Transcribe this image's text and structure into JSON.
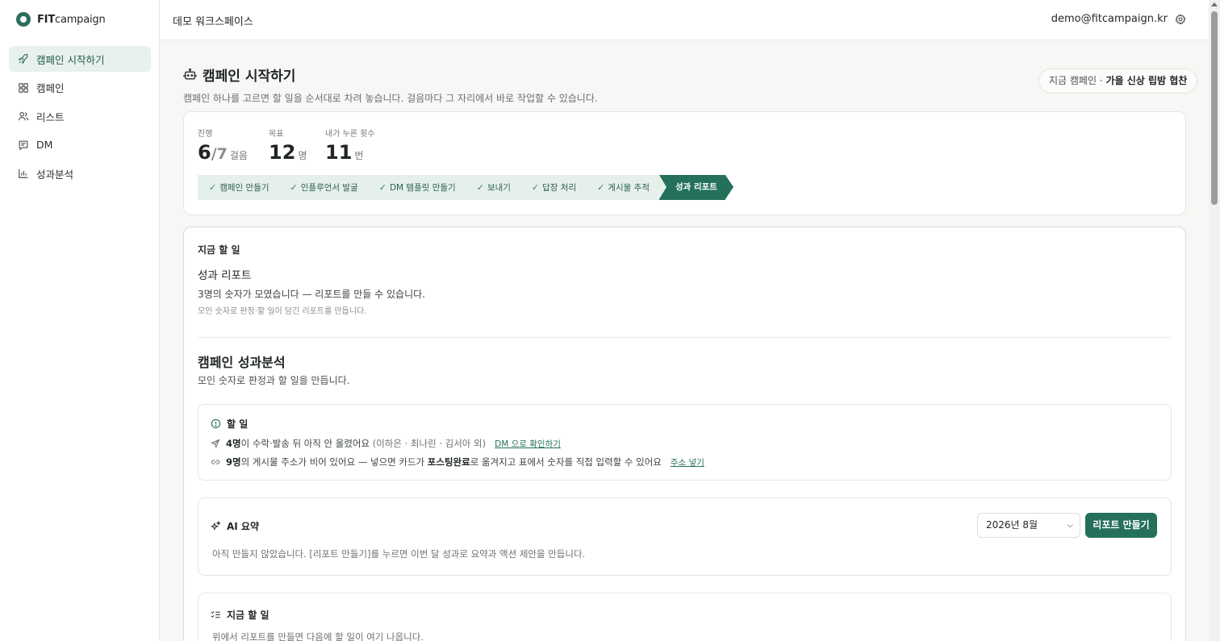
{
  "brand": {
    "name_bold": "FIT",
    "name_rest": "campaign"
  },
  "sidebar": {
    "items": [
      {
        "label": "캠페인 시작하기",
        "icon": "rocket-icon",
        "active": true
      },
      {
        "label": "캠페인",
        "icon": "grid-icon"
      },
      {
        "label": "리스트",
        "icon": "users-icon"
      },
      {
        "label": "DM",
        "icon": "message-icon"
      },
      {
        "label": "성과분석",
        "icon": "bar-chart-icon"
      }
    ]
  },
  "topbar": {
    "workspace": "데모 워크스페이스",
    "email": "demo@fitcampaign.kr",
    "settings_icon": "gear-icon"
  },
  "page": {
    "title": "캠페인 시작하기",
    "title_icon": "robot-icon",
    "subtitle": "캠페인 하나를 고르면 할 일을 순서대로 차려 놓습니다. 걸음마다 그 자리에서 바로 작업할 수 있습니다.",
    "current_label": "지금 캠페인 · ",
    "current_name": "가을 신상 립밤 협찬"
  },
  "progress": {
    "progress_label": "진행",
    "progress_value": "6",
    "progress_total": "/7",
    "progress_unit": "걸음",
    "goal_label": "목표",
    "goal_value": "12",
    "goal_unit": "명",
    "clicks_label": "내가 누른 횟수",
    "clicks_value": "11",
    "clicks_unit": "번",
    "steps": [
      {
        "label": "캠페인 만들기",
        "done": true
      },
      {
        "label": "인플루언서 발굴",
        "done": true
      },
      {
        "label": "DM 템플릿 만들기",
        "done": true
      },
      {
        "label": "보내기",
        "done": true
      },
      {
        "label": "답장 처리",
        "done": true
      },
      {
        "label": "게시물 추적",
        "done": true
      },
      {
        "label": "성과 리포트",
        "done": false,
        "current": true
      }
    ],
    "check_glyph": "✓"
  },
  "now": {
    "label": "지금 할 일",
    "title": "성과 리포트",
    "desc": "3명의 숫자가 모였습니다 — 리포트를 만들 수 있습니다.",
    "note": "모인 숫자로 판정·할 일이 담긴 리포트를 만듭니다."
  },
  "analysis": {
    "title": "캠페인 성과분석",
    "subtitle": "모인 숫자로 판정과 할 일을 만듭니다.",
    "todo": {
      "title": "할 일",
      "icon": "alert-circle-icon",
      "row1": {
        "icon": "send-icon",
        "count": "4명",
        "text": "이 수락·발송 뒤 아직 안 올렸어요",
        "names": "(이하은 · 최나린 · 김서아 외)",
        "link": "DM 으로 확인하기"
      },
      "row2": {
        "icon": "link-icon",
        "count": "9명",
        "text_a": "의 게시물 주소가 비어 있어요 — 넣으면 카드가 ",
        "bold": "포스팅완료",
        "text_b": "로 옮겨지고 표에서 숫자를 직접 입력할 수 있어요",
        "link": "주소 넣기"
      }
    },
    "ai": {
      "title": "AI 요약",
      "icon": "sparkles-icon",
      "month": "2026년 8월",
      "button": "리포트 만들기",
      "desc": "아직 만들지 않았습니다. [리포트 만들기]를 누르면 이번 달 성과로 요약과 액션 제안을 만듭니다."
    },
    "next": {
      "title": "지금 할 일",
      "icon": "list-check-icon",
      "desc": "위에서 리포트를 만들면 다음에 할 일이 여기 나옵니다."
    }
  },
  "colors": {
    "accent": "#24705b",
    "accent_soft": "#e6f0eb",
    "sidebar_active": "#e8f1ed"
  }
}
